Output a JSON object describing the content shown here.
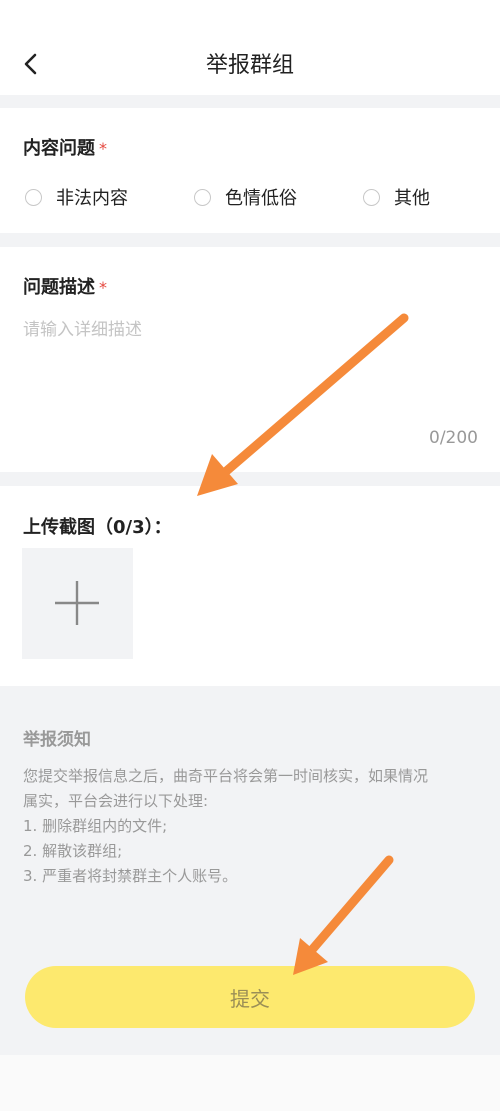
{
  "header": {
    "title": "举报群组"
  },
  "content_problem": {
    "label": "内容问题",
    "required_mark": "*",
    "options": [
      {
        "label": "非法内容"
      },
      {
        "label": "色情低俗"
      },
      {
        "label": "其他"
      }
    ]
  },
  "description": {
    "label": "问题描述",
    "required_mark": "*",
    "placeholder": "请输入详细描述",
    "counter": "0/200"
  },
  "upload": {
    "label": "上传截图（0/3）："
  },
  "notice": {
    "title": "举报须知",
    "lines": [
      "您提交举报信息之后，曲奇平台将会第一时间核实，如果情况",
      "属实，平台会进行以下处理:",
      "1. 删除群组内的文件;",
      "2. 解散该群组;",
      "3. 严重者将封禁群主个人账号。"
    ]
  },
  "submit": {
    "label": "提交"
  },
  "colors": {
    "accent": "#fde96e",
    "arrow": "#f58a3a",
    "required": "#e5483f"
  }
}
